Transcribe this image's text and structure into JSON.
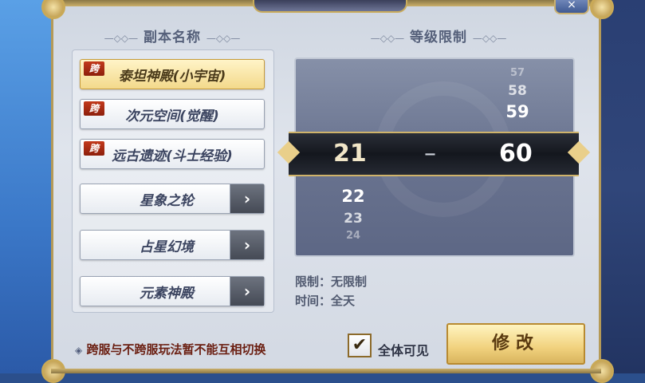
{
  "headers": {
    "dungeon_name": "副本名称",
    "level_limit": "等级限制",
    "decoration": "—◇◇—"
  },
  "close_label": "×",
  "dungeons": [
    {
      "tag": "跨",
      "label": "泰坦神殿(小宇宙)",
      "selected": true
    },
    {
      "tag": "跨",
      "label": "次元空间(觉醒)",
      "selected": false
    },
    {
      "tag": "跨",
      "label": "远古遗迹(斗士经验)",
      "selected": false
    },
    {
      "tag": "",
      "label": "星象之轮",
      "arrow": "›"
    },
    {
      "tag": "",
      "label": "占星幻境",
      "arrow": "›"
    },
    {
      "tag": "",
      "label": "元素神殿",
      "arrow": "›"
    }
  ],
  "level_picker": {
    "min_above": [],
    "min_selected": "21",
    "min_below": [
      "22",
      "23",
      "24"
    ],
    "max_above": [
      "57",
      "58",
      "59"
    ],
    "max_selected": "60",
    "separator": "–"
  },
  "info": {
    "limit_text": "限制：无限制",
    "time_text": "时间：全天"
  },
  "footer": {
    "note": "跨服与不跨服玩法暂不能互相切换",
    "note_bullet": "◈",
    "checkbox_mark": "✔",
    "checkbox_label": "全体可见",
    "modify_label": "修改"
  },
  "colors": {
    "panel": "#dfe4ec",
    "gold": "#c9ac5c",
    "accent_red": "#8d1f0c",
    "band": "#14171e"
  }
}
